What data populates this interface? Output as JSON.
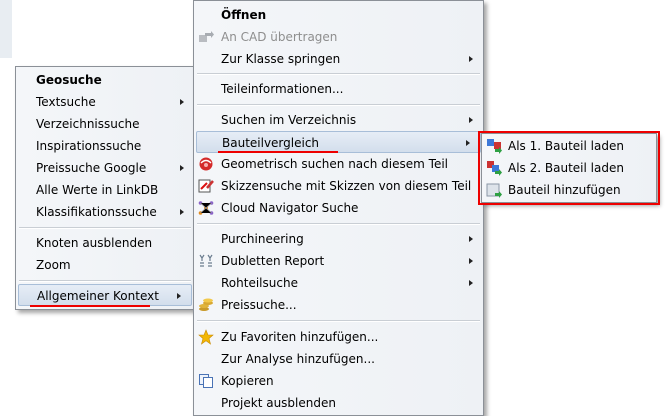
{
  "left_menu": {
    "items": [
      {
        "label": "Geosuche"
      },
      {
        "label": "Textsuche"
      },
      {
        "label": "Verzeichnissuche"
      },
      {
        "label": "Inspirationssuche"
      },
      {
        "label": "Preissuche Google"
      },
      {
        "label": "Alle Werte in LinkDB"
      },
      {
        "label": "Klassifikationssuche"
      },
      {
        "label": "Knoten ausblenden"
      },
      {
        "label": "Zoom"
      },
      {
        "label": "Allgemeiner Kontext"
      }
    ]
  },
  "main_menu": {
    "items": [
      {
        "label": "Öffnen"
      },
      {
        "label": "An CAD übertragen"
      },
      {
        "label": "Zur Klasse springen"
      },
      {
        "label": "Teileinformationen..."
      },
      {
        "label": "Suchen im Verzeichnis"
      },
      {
        "label": "Bauteilvergleich"
      },
      {
        "label": "Geometrisch suchen nach diesem Teil"
      },
      {
        "label": "Skizzensuche mit Skizzen von diesem Teil"
      },
      {
        "label": "Cloud Navigator Suche"
      },
      {
        "label": "Purchineering"
      },
      {
        "label": "Dubletten Report"
      },
      {
        "label": "Rohteilsuche"
      },
      {
        "label": "Preissuche..."
      },
      {
        "label": "Zu Favoriten hinzufügen..."
      },
      {
        "label": "Zur Analyse hinzufügen..."
      },
      {
        "label": "Kopieren"
      },
      {
        "label": "Projekt ausblenden"
      }
    ]
  },
  "sub_menu": {
    "items": [
      {
        "label": "Als 1. Bauteil laden"
      },
      {
        "label": "Als 2. Bauteil laden"
      },
      {
        "label": "Bauteil hinzufügen"
      }
    ]
  },
  "colors": {
    "annotation": "#e00000",
    "highlight": "#d3deec"
  }
}
